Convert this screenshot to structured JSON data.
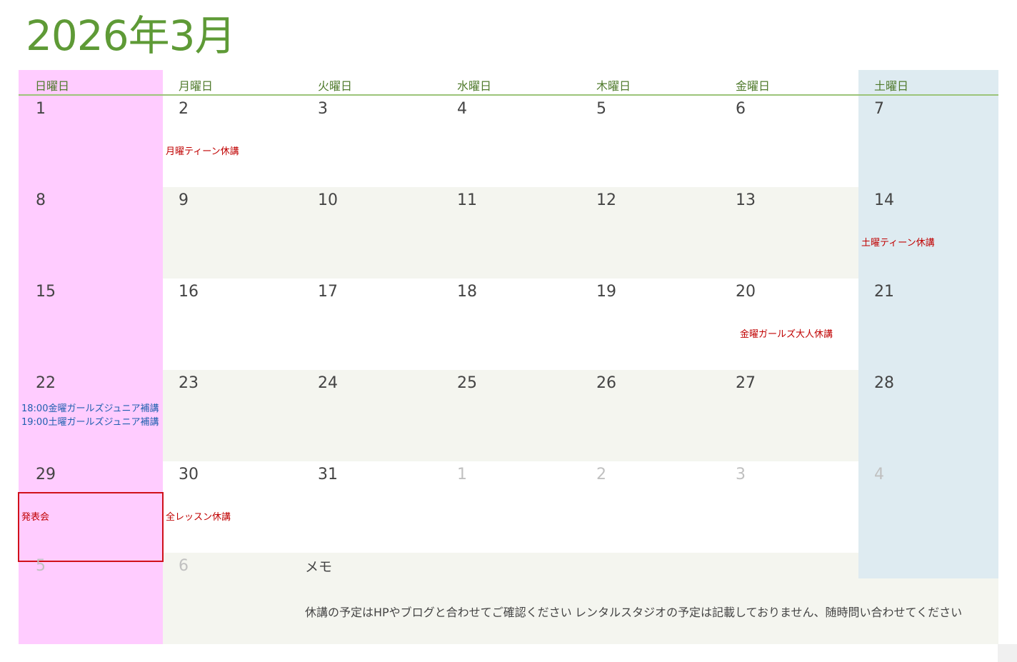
{
  "title": "2026年3月",
  "weekdays": [
    "日曜日",
    "月曜日",
    "火曜日",
    "水曜日",
    "木曜日",
    "金曜日",
    "土曜日"
  ],
  "weeks": [
    [
      {
        "d": "1"
      },
      {
        "d": "2",
        "ev": [
          {
            "t": "月曜ティーン休講",
            "c": "red"
          }
        ]
      },
      {
        "d": "3"
      },
      {
        "d": "4"
      },
      {
        "d": "5"
      },
      {
        "d": "6"
      },
      {
        "d": "7"
      }
    ],
    [
      {
        "d": "8"
      },
      {
        "d": "9"
      },
      {
        "d": "10"
      },
      {
        "d": "11"
      },
      {
        "d": "12"
      },
      {
        "d": "13"
      },
      {
        "d": "14",
        "ev": [
          {
            "t": "土曜ティーン休講",
            "c": "red"
          }
        ]
      }
    ],
    [
      {
        "d": "15"
      },
      {
        "d": "16"
      },
      {
        "d": "17"
      },
      {
        "d": "18"
      },
      {
        "d": "19"
      },
      {
        "d": "20",
        "ev": [
          {
            "t": "金曜ガールズ大人休講",
            "c": "red",
            "indent": 4
          }
        ]
      },
      {
        "d": "21"
      }
    ],
    [
      {
        "d": "22",
        "ev": [
          {
            "t": "18:00金曜ガールズジュニア補講",
            "c": "blue"
          },
          {
            "t": "19:00土曜ガールズジュニア補講",
            "c": "blue"
          }
        ]
      },
      {
        "d": "23"
      },
      {
        "d": "24"
      },
      {
        "d": "25"
      },
      {
        "d": "26"
      },
      {
        "d": "27"
      },
      {
        "d": "28"
      }
    ],
    [
      {
        "d": "29",
        "ev": [
          {
            "t": "発表会",
            "c": "red"
          }
        ],
        "marked": true
      },
      {
        "d": "30",
        "ev": [
          {
            "t": "全レッスン休講",
            "c": "red"
          }
        ]
      },
      {
        "d": "31"
      },
      {
        "d": "1",
        "dim": true
      },
      {
        "d": "2",
        "dim": true
      },
      {
        "d": "3",
        "dim": true
      },
      {
        "d": "4",
        "dim": true
      }
    ],
    [
      {
        "d": "5",
        "dim": true
      },
      {
        "d": "6",
        "dim": true
      }
    ]
  ],
  "memo": {
    "title": "メモ",
    "lines": [
      "休講の予定はHPやブログと合わせてご確認ください",
      "レンタルスタジオの予定は記載しておりません、随時問い合わせてください"
    ]
  },
  "colors": {
    "sunday_bg": "#ffccff",
    "saturday_bg": "#deebf1",
    "alt_row_bg": "#f4f5ef",
    "title": "#5e9a36",
    "event_red": "#c00000",
    "event_blue": "#2060b0",
    "mark_border": "#d0101a"
  }
}
